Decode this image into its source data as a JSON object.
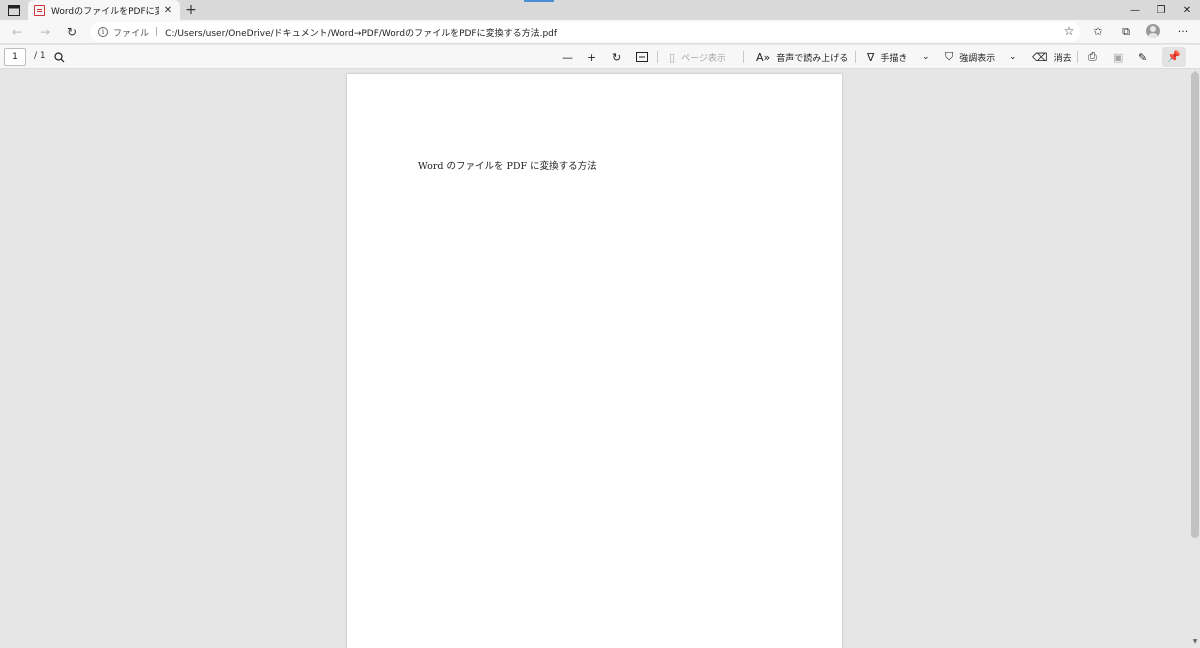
{
  "tab": {
    "title": "WordのファイルをPDFに変換する方法",
    "close": "✕",
    "new_tab": "+"
  },
  "window": {
    "minimize": "—",
    "restore": "❐",
    "close": "✕"
  },
  "address": {
    "scheme_label": "ファイル",
    "separator": "|",
    "url": "C:/Users/user/OneDrive/ドキュメント/Word→PDF/WordのファイルをPDFに変換する方法.pdf"
  },
  "pdf_toolbar": {
    "page_current": "1",
    "page_total": "/ 1",
    "page_view": "ページ表示",
    "read_aloud": "音声で読み上げる",
    "draw": "手描き",
    "highlight": "強調表示",
    "erase": "消去"
  },
  "document": {
    "text": "Word のファイルを PDF に変換する方法"
  },
  "colors": {
    "accent": "#4a8fd6",
    "pdf_red": "#d13438"
  }
}
